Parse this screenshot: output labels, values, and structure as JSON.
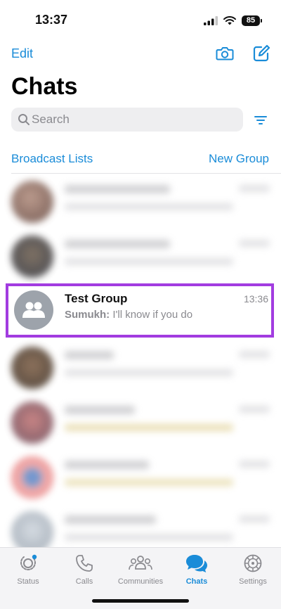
{
  "status_bar": {
    "time": "13:37",
    "battery": "85"
  },
  "header": {
    "edit_label": "Edit",
    "title": "Chats"
  },
  "search": {
    "placeholder": "Search"
  },
  "links": {
    "broadcast_lists": "Broadcast Lists",
    "new_group": "New Group"
  },
  "highlighted_chat": {
    "name": "Test Group",
    "time": "13:36",
    "sender": "Sumukh:",
    "message": " I'll know if you do"
  },
  "tabs": [
    {
      "label": "Status",
      "icon": "status-icon"
    },
    {
      "label": "Calls",
      "icon": "phone-icon"
    },
    {
      "label": "Communities",
      "icon": "communities-icon"
    },
    {
      "label": "Chats",
      "icon": "chat-bubbles-icon",
      "active": true
    },
    {
      "label": "Settings",
      "icon": "gear-icon"
    }
  ],
  "colors": {
    "accent": "#1a8cd8",
    "highlight_border": "#a23ce0",
    "avatar_grey": "#9da3ab"
  }
}
